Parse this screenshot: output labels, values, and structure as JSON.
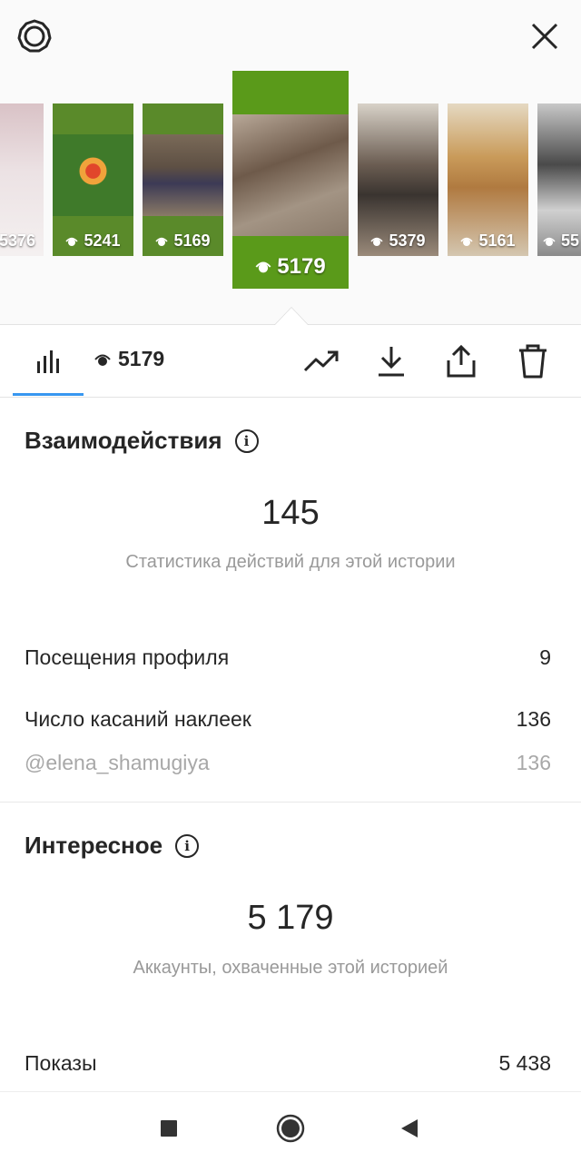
{
  "header": {
    "settings_icon": "gear-icon",
    "close_icon": "close-icon"
  },
  "stories": [
    {
      "views": "5376",
      "bg": "#c9c4c8"
    },
    {
      "views": "5241",
      "bg": "#5a8a2a"
    },
    {
      "views": "5169",
      "bg": "#5a8a2a"
    },
    {
      "views": "5179",
      "bg": "#5a9a1a",
      "selected": true
    },
    {
      "views": "5379",
      "bg": "#8a8278"
    },
    {
      "views": "5161",
      "bg": "#c7b49a"
    },
    {
      "views": "55",
      "bg": "#9a9a9a"
    }
  ],
  "tabbar": {
    "views": "5179",
    "icons": [
      "bar-chart-icon",
      "eye-icon",
      "trending-icon",
      "download-icon",
      "share-icon",
      "trash-icon"
    ]
  },
  "interactions": {
    "title": "Взаимодействия",
    "total": "145",
    "caption": "Статистика действий для этой истории",
    "rows": [
      {
        "label": "Посещения профиля",
        "value": "9"
      },
      {
        "label": "Число касаний наклеек",
        "value": "136"
      },
      {
        "label": "@elena_shamugiya",
        "value": "136"
      }
    ]
  },
  "discovery": {
    "title": "Интересное",
    "total": "5 179",
    "caption": "Аккаунты, охваченные этой историей",
    "rows": [
      {
        "label": "Показы",
        "value": "5 438"
      }
    ]
  },
  "colors": {
    "accent": "#3897f0",
    "text": "#262626",
    "muted": "#999999"
  }
}
